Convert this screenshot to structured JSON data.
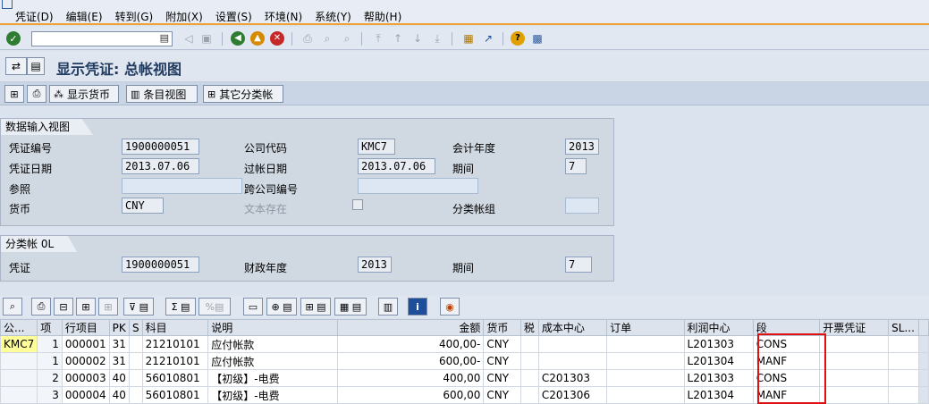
{
  "menu": [
    "凭证(D)",
    "编辑(E)",
    "转到(G)",
    "附加(X)",
    "设置(S)",
    "环境(N)",
    "系统(Y)",
    "帮助(H)"
  ],
  "toolbar": {
    "command_value": "",
    "icons": [
      "enter-icon",
      "save-icon",
      "back-icon",
      "exit-icon",
      "cancel-icon",
      "print-icon",
      "find-icon",
      "find-next-icon",
      "first-page-icon",
      "prev-page-icon",
      "next-page-icon",
      "last-page-icon",
      "create-session-icon",
      "shortcut-icon",
      "help-icon",
      "customize-icon"
    ]
  },
  "title": "显示凭证: 总帐视图",
  "app_toolbar": {
    "display_currency": "显示货币",
    "entry_view": "条目视图",
    "other_ledger": "其它分类帐"
  },
  "header_group": {
    "title": "数据输入视图",
    "doc_number_label": "凭证编号",
    "doc_number": "1900000051",
    "company_code_label": "公司代码",
    "company_code": "KMC7",
    "fiscal_year_label": "会计年度",
    "fiscal_year": "2013",
    "doc_date_label": "凭证日期",
    "doc_date": "2013.07.06",
    "posting_date_label": "过帐日期",
    "posting_date": "2013.07.06",
    "period_label": "期间",
    "period": "7",
    "reference_label": "参照",
    "reference": "",
    "cross_company_label": "跨公司编号",
    "cross_company": "",
    "currency_label": "货币",
    "currency": "CNY",
    "text_exists_label": "文本存在",
    "ledger_group_label": "分类帐组",
    "ledger_group": ""
  },
  "ledger_group": {
    "title": "分类帐 0L",
    "doc_label": "凭证",
    "doc": "1900000051",
    "fiscal_year_label": "财政年度",
    "fiscal_year": "2013",
    "period_label": "期间",
    "period": "7"
  },
  "grid": {
    "columns": [
      "公...",
      "项",
      "行项目",
      "PK",
      "S",
      "科目",
      "说明",
      "金额",
      "货币",
      "税",
      "成本中心",
      "订单",
      "利润中心",
      "段",
      "开票凭证",
      "SL..."
    ],
    "rows": [
      {
        "company": "KMC7",
        "item": "1",
        "line": "000001",
        "pk": "31",
        "s": "",
        "account": "21210101",
        "desc": "应付帐款",
        "amount": "400,00-",
        "currency": "CNY",
        "tax": "",
        "cost_center": "",
        "order": "",
        "profit_center": "L201303",
        "segment": "CONS",
        "billing_doc": "",
        "sl": ""
      },
      {
        "company": "",
        "item": "1",
        "line": "000002",
        "pk": "31",
        "s": "",
        "account": "21210101",
        "desc": "应付帐款",
        "amount": "600,00-",
        "currency": "CNY",
        "tax": "",
        "cost_center": "",
        "order": "",
        "profit_center": "L201304",
        "segment": "MANF",
        "billing_doc": "",
        "sl": ""
      },
      {
        "company": "",
        "item": "2",
        "line": "000003",
        "pk": "40",
        "s": "",
        "account": "56010801",
        "desc": "【初级】-电费",
        "amount": "400,00",
        "currency": "CNY",
        "tax": "",
        "cost_center": "C201303",
        "order": "",
        "profit_center": "L201303",
        "segment": "CONS",
        "billing_doc": "",
        "sl": ""
      },
      {
        "company": "",
        "item": "3",
        "line": "000004",
        "pk": "40",
        "s": "",
        "account": "56010801",
        "desc": "【初级】-电费",
        "amount": "600,00",
        "currency": "CNY",
        "tax": "",
        "cost_center": "C201306",
        "order": "",
        "profit_center": "L201304",
        "segment": "MANF",
        "billing_doc": "",
        "sl": ""
      }
    ]
  },
  "colors": {
    "highlight": "#e01010",
    "menu_accent": "#f0a030",
    "company_cell": "#ffff99"
  }
}
